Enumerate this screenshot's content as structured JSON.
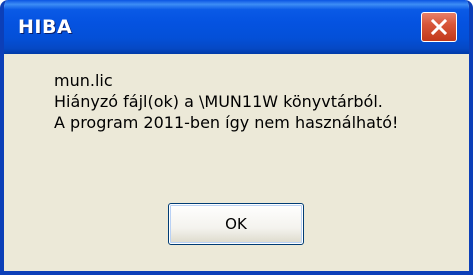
{
  "window": {
    "title": "HIBA",
    "close_icon": "close-icon"
  },
  "message": {
    "lines": [
      "mun.lic",
      "Hiányzó fájl(ok) a \\MUN11W könyvtárból.",
      "A program 2011-ben így nem használható!"
    ]
  },
  "buttons": {
    "ok_label": "OK"
  },
  "colors": {
    "titlebar": "#0553e1",
    "border": "#0c3fb8",
    "close_button": "#d8573a",
    "body_background": "#ece9d8"
  }
}
